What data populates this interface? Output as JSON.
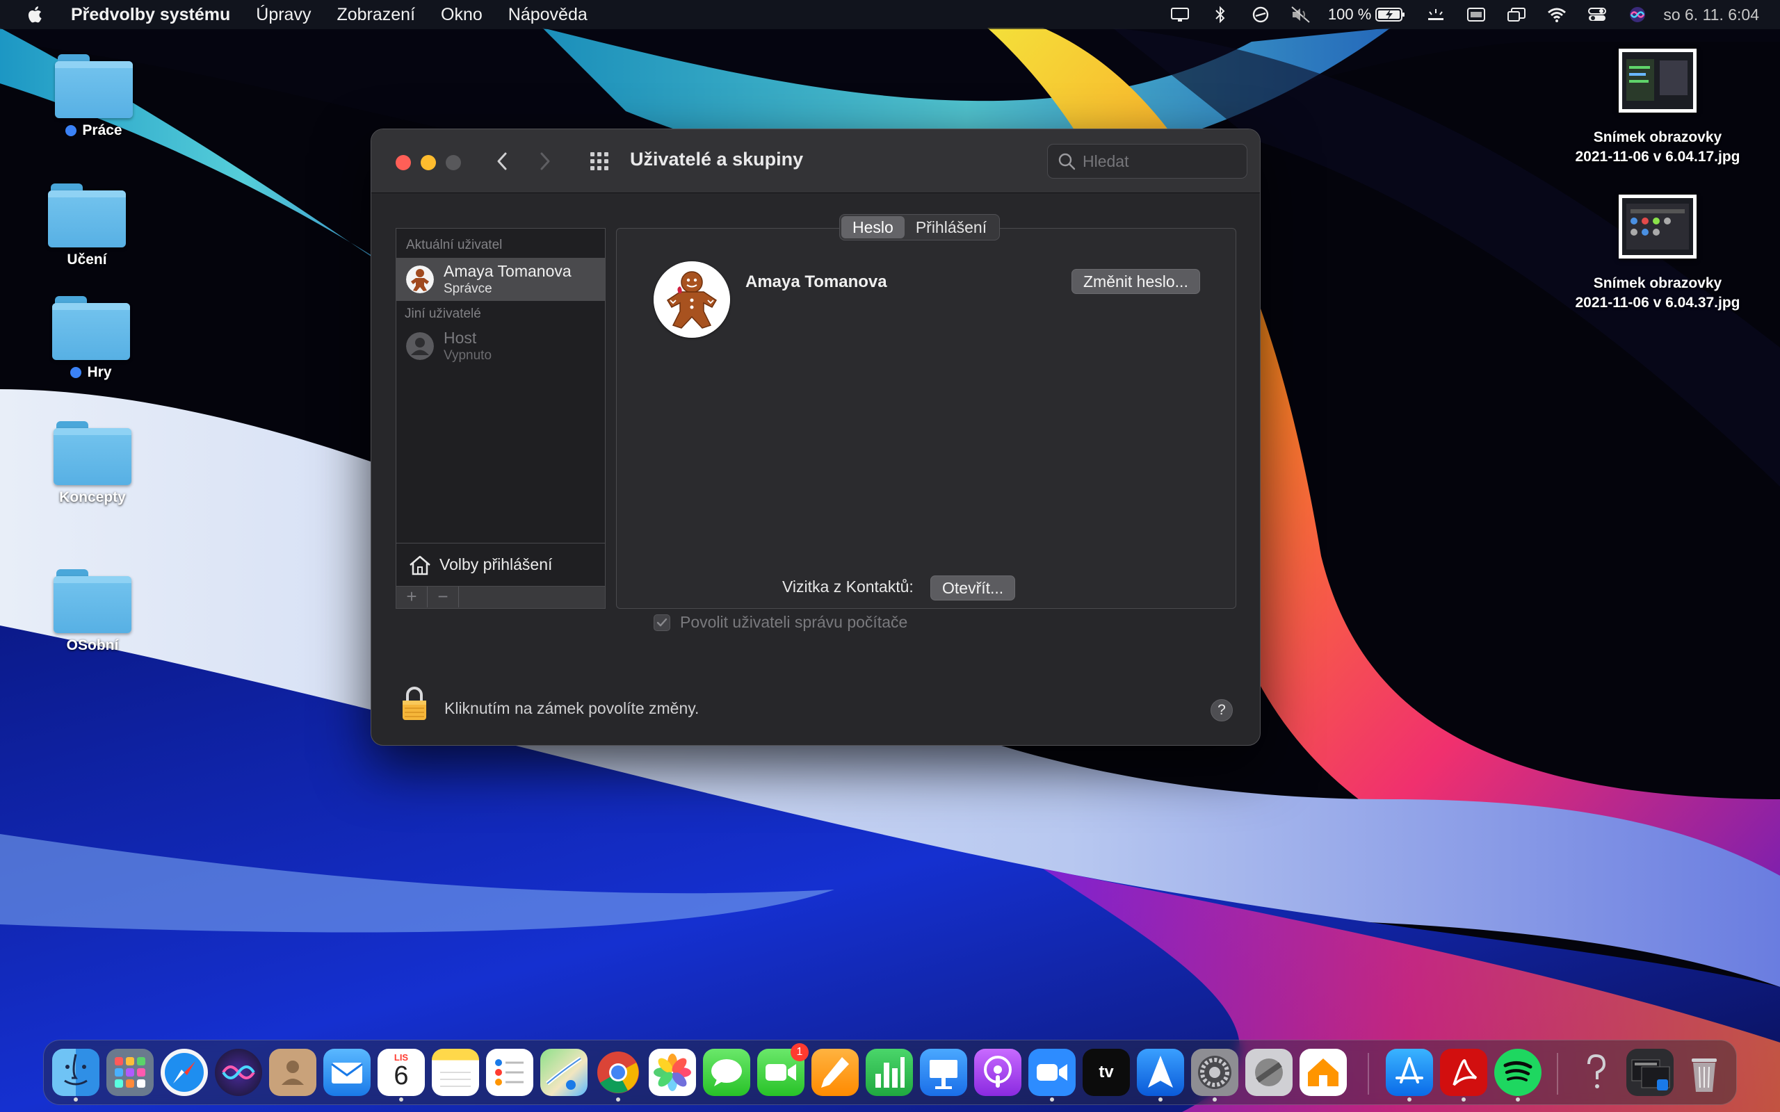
{
  "menubar": {
    "app_name": "Předvolby systému",
    "menus": [
      "Úpravy",
      "Zobrazení",
      "Okno",
      "Nápověda"
    ],
    "battery_percent": "100 %",
    "clock": "so 6. 11. 6:04"
  },
  "desktop": {
    "folders": [
      {
        "label": "Práce",
        "tag_color": "#3b82f6"
      },
      {
        "label": "Učení",
        "tag_color": ""
      },
      {
        "label": "Hry",
        "tag_color": "#3b82f6"
      },
      {
        "label": "Koncepty",
        "tag_color": ""
      },
      {
        "label": "OSobní",
        "tag_color": ""
      }
    ],
    "screenshots": [
      {
        "label_line1": "Snímek obrazovky",
        "label_line2": "2021-11-06 v 6.04.17.jpg"
      },
      {
        "label_line1": "Snímek obrazovky",
        "label_line2": "2021-11-06 v 6.04.37.jpg"
      }
    ]
  },
  "window": {
    "title": "Uživatelé a skupiny",
    "search_placeholder": "Hledat",
    "sidebar": {
      "current_header": "Aktuální uživatel",
      "current_user": {
        "name": "Amaya Tomanova",
        "role": "Správce"
      },
      "other_header": "Jiní uživatelé",
      "other_user": {
        "name": "Host",
        "role": "Vypnuto"
      },
      "login_options": "Volby přihlášení",
      "add": "+",
      "remove": "−"
    },
    "tabs": [
      {
        "label": "Heslo",
        "active": true
      },
      {
        "label": "Přihlášení",
        "active": false
      }
    ],
    "user_name": "Amaya Tomanova",
    "change_password": "Změnit heslo...",
    "contact_card_label": "Vizitka z Kontaktů:",
    "open_button": "Otevřít...",
    "admin_checkbox_label": "Povolit uživateli správu počítače",
    "admin_checked": true,
    "lock_text": "Kliknutím na zámek povolíte změny.",
    "help": "?"
  },
  "dock": {
    "calendar_month": "LIS",
    "calendar_day": "6",
    "facetime_badge": "1",
    "tv_label": "tv"
  },
  "colors": {
    "close": "#ff5f57",
    "minimize": "#febc2e",
    "accent": "#3b82f6"
  }
}
